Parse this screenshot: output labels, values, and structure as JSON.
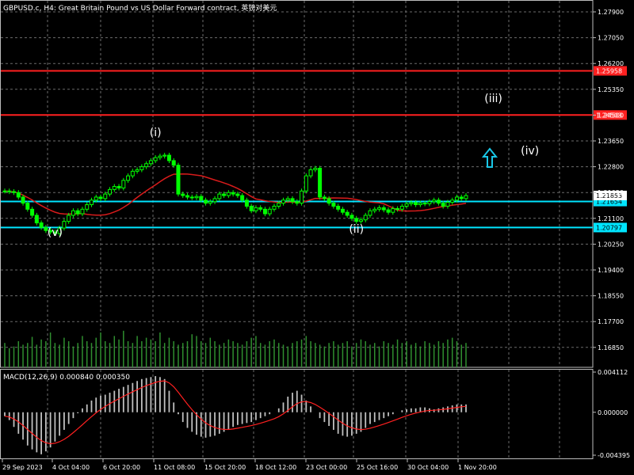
{
  "window": {
    "title": "GBPUSD.c, H4:  Great Britain Pound vs US Dollar Forward contract, 英镑对美元"
  },
  "colors": {
    "background": "#000000",
    "grid": "#6b6b6b",
    "text": "#ffffff",
    "candle": "#00ff00",
    "volume": "#2f8f2f",
    "ma": "#d81b1b",
    "resistance": "#ff2020",
    "support": "#00e5ff",
    "arrow": "#19c6e6",
    "macd_hist": "#c0c0c0",
    "macd_signal": "#ff2020"
  },
  "price_axis": {
    "ticks": [
      "1.27900",
      "1.27050",
      "1.26200",
      "1.25350",
      "1.24500",
      "1.23650",
      "1.22800",
      "1.21950",
      "1.21100",
      "1.20250",
      "1.19400",
      "1.18550",
      "1.17700",
      "1.16850"
    ]
  },
  "levels": [
    {
      "name": "resistance-upper",
      "price": 1.25958,
      "label": "1.25958",
      "kind": "resistance"
    },
    {
      "name": "resistance-lower",
      "price": 1.24503,
      "label": "1.24503",
      "kind": "resistance"
    },
    {
      "name": "support-upper",
      "price": 1.21654,
      "label": "1.21654",
      "kind": "support"
    },
    {
      "name": "support-lower",
      "price": 1.20797,
      "label": "1.20797",
      "kind": "support"
    }
  ],
  "price_tag": {
    "price": 1.21853,
    "label": "1.21853"
  },
  "wave_labels": [
    {
      "text": "(i)",
      "bar": 33
    },
    {
      "text": "(ii)",
      "bar": 77
    },
    {
      "text": "(iii)",
      "bar": 107
    },
    {
      "text": "(iv)",
      "bar": 115
    },
    {
      "text": "(v)",
      "bar": 11
    }
  ],
  "arrow_icon": {
    "name": "arrow-up-icon",
    "bar": 102,
    "price": 1.2315
  },
  "time_axis": {
    "labels": [
      "29 Sep 2023",
      "4 Oct 04:00",
      "6 Oct 20:00",
      "11 Oct 08:00",
      "15 Oct 20:00",
      "18 Oct 12:00",
      "23 Oct 00:00",
      "25 Oct 16:00",
      "30 Oct 04:00",
      "1 Nov 20:00"
    ]
  },
  "macd": {
    "title": "MACD(12,26,9) 0.000840 0.000350",
    "ticks": [
      "0.004112",
      "0.000000",
      "-0.004395"
    ]
  },
  "chart_data": {
    "type": "candlestick",
    "symbol": "GBPUSD.c",
    "timeframe": "H4",
    "ylim": [
      1.162,
      1.283
    ],
    "ma_period_note": "",
    "closes": [
      1.22,
      1.2198,
      1.2195,
      1.218,
      1.216,
      1.214,
      1.212,
      1.2095,
      1.208,
      1.207,
      1.2065,
      1.206,
      1.2078,
      1.21,
      1.212,
      1.2135,
      1.2125,
      1.214,
      1.2155,
      1.217,
      1.218,
      1.2175,
      1.219,
      1.2205,
      1.2215,
      1.221,
      1.2235,
      1.225,
      1.2265,
      1.227,
      1.228,
      1.229,
      1.23,
      1.231,
      1.2315,
      1.2318,
      1.23,
      1.2285,
      1.219,
      1.2185,
      1.218,
      1.2178,
      1.2182,
      1.217,
      1.216,
      1.2165,
      1.2175,
      1.219,
      1.2185,
      1.2195,
      1.219,
      1.2185,
      1.217,
      1.215,
      1.2135,
      1.2145,
      1.214,
      1.2125,
      1.214,
      1.215,
      1.216,
      1.217,
      1.2175,
      1.2165,
      1.216,
      1.22,
      1.225,
      1.227,
      1.2275,
      1.218,
      1.2175,
      1.216,
      1.215,
      1.214,
      1.213,
      1.212,
      1.211,
      1.21,
      1.2105,
      1.212,
      1.2135,
      1.214,
      1.2145,
      1.2138,
      1.213,
      1.2142,
      1.214,
      1.215,
      1.2158,
      1.2162,
      1.2155,
      1.216,
      1.2158,
      1.2165,
      1.217,
      1.216,
      1.215,
      1.2163,
      1.217,
      1.218,
      1.2175,
      1.2185
    ],
    "volume": [
      28,
      22,
      24,
      30,
      26,
      28,
      35,
      26,
      32,
      30,
      40,
      28,
      26,
      34,
      30,
      24,
      28,
      36,
      30,
      28,
      34,
      40,
      30,
      28,
      36,
      32,
      42,
      30,
      28,
      36,
      30,
      34,
      32,
      30,
      40,
      28,
      34,
      30,
      26,
      28,
      30,
      38,
      36,
      30,
      28,
      34,
      30,
      26,
      28,
      32,
      30,
      28,
      26,
      30,
      34,
      36,
      28,
      26,
      30,
      32,
      28,
      26,
      24,
      28,
      30,
      32,
      36,
      30,
      28,
      26,
      24,
      28,
      30,
      26,
      28,
      30,
      24,
      28,
      32,
      30,
      26,
      28,
      24,
      30,
      28,
      26,
      32,
      28,
      30,
      26,
      28,
      24,
      30,
      28,
      26,
      30,
      28,
      32,
      34,
      30,
      26,
      28
    ],
    "macd_hist": [
      -0.0004,
      -0.0008,
      -0.0015,
      -0.0022,
      -0.0028,
      -0.0034,
      -0.0038,
      -0.0041,
      -0.0043,
      -0.004,
      -0.0036,
      -0.003,
      -0.0024,
      -0.0018,
      -0.0012,
      -0.0006,
      -0.0001,
      0.0004,
      0.0008,
      0.0012,
      0.0015,
      0.0017,
      0.0018,
      0.002,
      0.0022,
      0.0024,
      0.0026,
      0.0028,
      0.003,
      0.0032,
      0.0034,
      0.0035,
      0.0036,
      0.0037,
      0.0036,
      0.0034,
      0.0022,
      0.001,
      -0.0002,
      -0.001,
      -0.0016,
      -0.002,
      -0.0023,
      -0.0025,
      -0.0026,
      -0.0025,
      -0.0024,
      -0.0022,
      -0.002,
      -0.0018,
      -0.0015,
      -0.0013,
      -0.0012,
      -0.0011,
      -0.001,
      -0.0008,
      -0.0006,
      -0.0004,
      -0.0002,
      0.0,
      0.0004,
      0.001,
      0.0016,
      0.002,
      0.0022,
      0.0018,
      0.0012,
      0.0006,
      0.0,
      -0.0006,
      -0.001,
      -0.0014,
      -0.0018,
      -0.0022,
      -0.0024,
      -0.0025,
      -0.0024,
      -0.0022,
      -0.002,
      -0.0016,
      -0.0012,
      -0.001,
      -0.0008,
      -0.0006,
      -0.0004,
      -0.0002,
      0.0,
      0.0002,
      0.0003,
      0.0004,
      0.0004,
      0.0005,
      0.0005,
      0.0004,
      0.0003,
      0.0004,
      0.0005,
      0.0006,
      0.0007,
      0.0008,
      0.0008,
      0.0008
    ],
    "macd_range": [
      -0.004395,
      0.004112
    ]
  }
}
